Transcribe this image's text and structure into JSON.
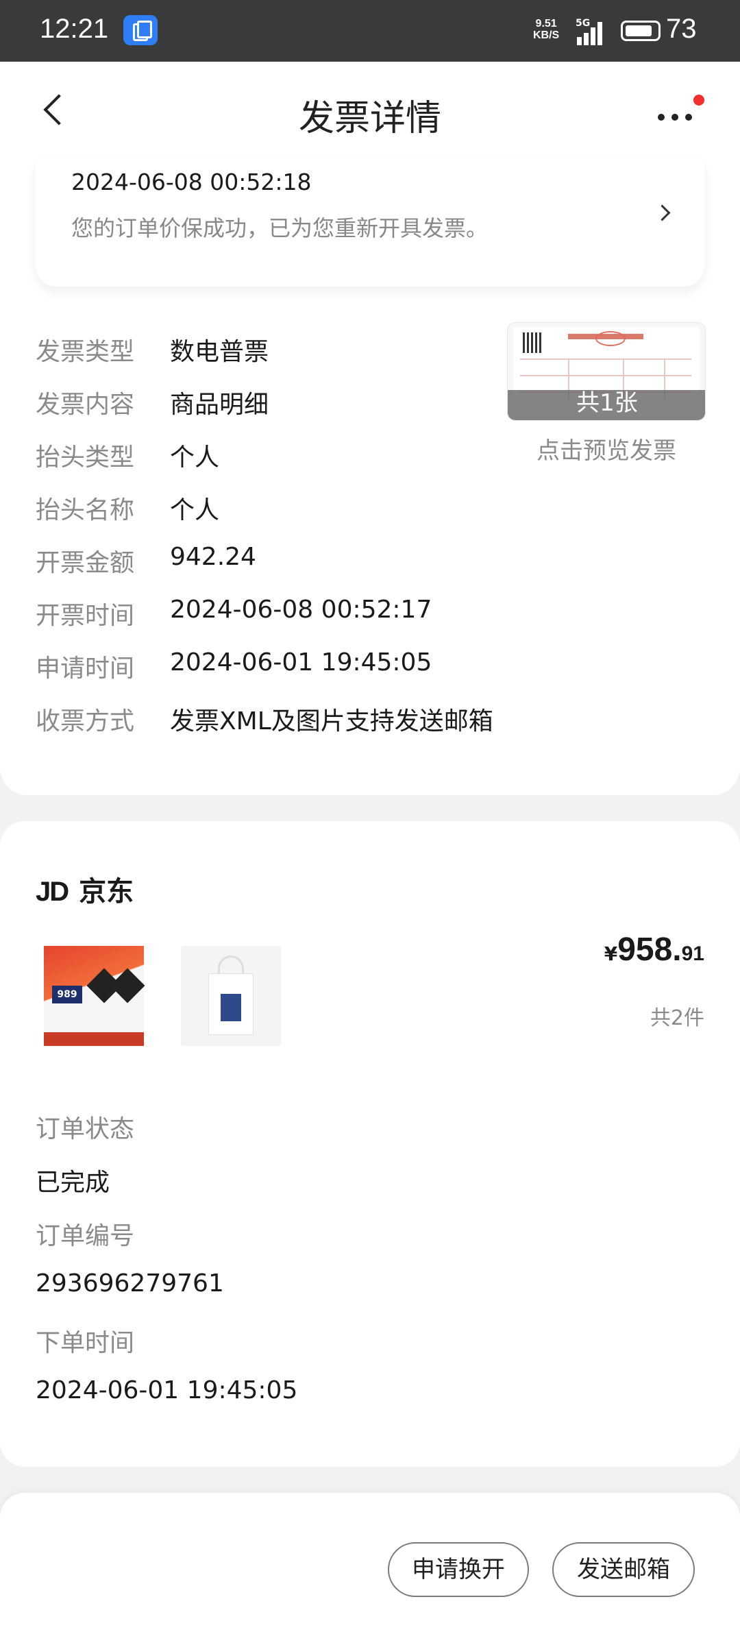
{
  "status_bar": {
    "time": "12:21",
    "net_speed_value": "9.51",
    "net_speed_unit": "KB/S",
    "network": "5G",
    "battery": "73"
  },
  "header": {
    "title": "发票详情",
    "back_icon": "chevron-left-icon",
    "more_icon": "more-dots-icon",
    "badge_color": "#f23030"
  },
  "notice": {
    "time": "2024-06-08 00:52:18",
    "text": "您的订单价保成功，已为您重新开具发票。"
  },
  "invoice": {
    "rows": [
      {
        "label": "发票类型",
        "value": "数电普票"
      },
      {
        "label": "发票内容",
        "value": "商品明细"
      },
      {
        "label": "抬头类型",
        "value": "个人"
      },
      {
        "label": "抬头名称",
        "value": "个人"
      },
      {
        "label": "开票金额",
        "value": "942.24"
      },
      {
        "label": "开票时间",
        "value": "2024-06-08 00:52:17"
      },
      {
        "label": "申请时间",
        "value": "2024-06-01 19:45:05"
      },
      {
        "label": "收票方式",
        "value": "发票XML及图片支持发送邮箱"
      }
    ],
    "preview_count": "共1张",
    "preview_link": "点击预览发票"
  },
  "order": {
    "shop_logo": "JD",
    "shop_name": "京东",
    "product1_badge": "989",
    "price_currency": "¥",
    "price_integer": "958.",
    "price_decimal": "91",
    "item_count": "共2件",
    "status_label": "订单状态",
    "status_value": "已完成",
    "number_label": "订单编号",
    "number_value": "293696279761",
    "time_label": "下单时间",
    "time_value": "2024-06-01 19:45:05"
  },
  "actions": {
    "reissue": "申请换开",
    "send_email": "发送邮箱"
  }
}
